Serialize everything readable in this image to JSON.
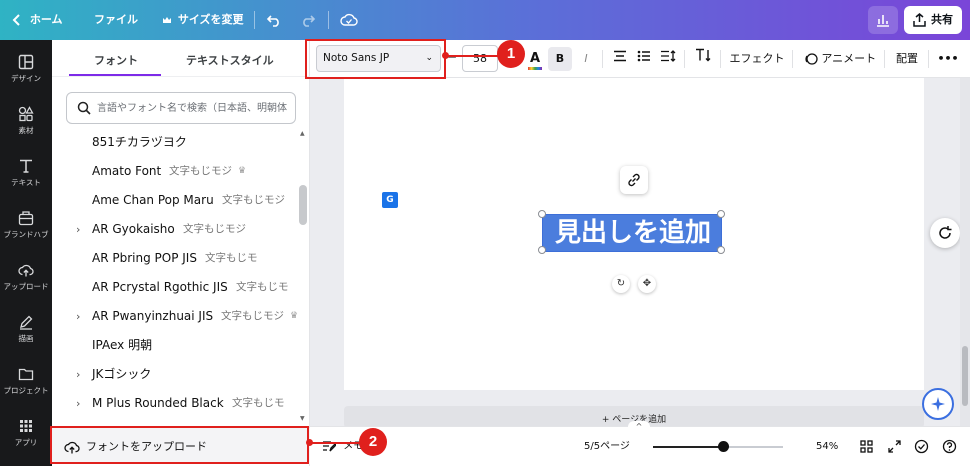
{
  "topbar": {
    "home": "ホーム",
    "file": "ファイル",
    "resize": "サイズを変更",
    "share": "共有"
  },
  "rail": {
    "items": [
      "デザイン",
      "素材",
      "テキスト",
      "ブランドハブ",
      "アップロード",
      "描画",
      "プロジェクト",
      "アプリ"
    ]
  },
  "panel": {
    "tabs": [
      "フォント",
      "テキストスタイル"
    ],
    "search_placeholder": "言語やフォント名で検索（日本語、明朝体",
    "fonts": [
      {
        "name": "851チカラヅヨク",
        "sample": "",
        "crown": false,
        "chevron": false
      },
      {
        "name": "Amato Font",
        "sample": "文字もじモジ",
        "crown": true,
        "chevron": false
      },
      {
        "name": "Ame Chan Pop Maru",
        "sample": "文字もじモジ",
        "crown": false,
        "chevron": false
      },
      {
        "name": "AR Gyokaisho",
        "sample": "文字もじモジ",
        "crown": false,
        "chevron": true
      },
      {
        "name": "AR Pbring POP JIS",
        "sample": "文字もじモ",
        "crown": false,
        "chevron": false
      },
      {
        "name": "AR Pcrystal Rgothic JIS",
        "sample": "文字もじモ",
        "crown": false,
        "chevron": false
      },
      {
        "name": "AR Pwanyinzhuai JIS",
        "sample": "文字もじモジ",
        "crown": true,
        "chevron": true
      },
      {
        "name": "IPAex 明朝",
        "sample": "",
        "crown": false,
        "chevron": false
      },
      {
        "name": "JKゴシック",
        "sample": "",
        "crown": false,
        "chevron": true
      },
      {
        "name": "M Plus Rounded Black",
        "sample": "文字もじモ",
        "crown": false,
        "chevron": true
      }
    ],
    "upload_label": "フォントをアップロード"
  },
  "toolbar": {
    "font_family": "Noto Sans JP",
    "font_size": "58",
    "effects": "エフェクト",
    "animate": "アニメート",
    "position": "配置"
  },
  "canvas": {
    "heading": "見出しを追加",
    "add_page": "+ ページを追加"
  },
  "bottombar": {
    "notes": "メモ",
    "page_indicator": "5/5ページ",
    "zoom": "54%",
    "zoom_fraction": 0.54
  },
  "callouts": [
    "1",
    "2"
  ],
  "colors": {
    "accent": "#7d2ae8",
    "selection": "#4b7ddd",
    "callout": "#e0201d"
  }
}
